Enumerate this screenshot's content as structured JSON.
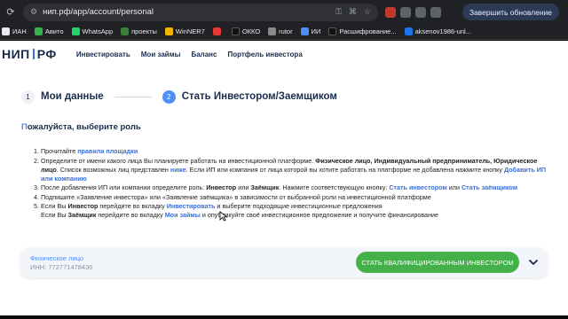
{
  "browser": {
    "url": "нип.рф/app/account/personal",
    "update_button": "Завершить обновление",
    "bookmarks": [
      "ИАН",
      "Авито",
      "WhatsApp",
      "проекты",
      "WinNER7",
      "",
      "ОККО",
      "rutor",
      "ИИ",
      "Расшифрование...",
      "aksenov1986-unl..."
    ],
    "bookmark_colors": [
      "#e8eaed",
      "#37b24d",
      "#25d366",
      "#3b7d3b",
      "#f5b400",
      "#e53935",
      "#111111",
      "#8a8a8a",
      "#4f8ef7",
      "#111111",
      "#1a73e8"
    ]
  },
  "site": {
    "logo_left": "НИП",
    "logo_right": "РФ",
    "menu": [
      "Инвестировать",
      "Мои займы",
      "Баланс",
      "Портфель инвестора"
    ]
  },
  "steps": [
    {
      "num": "1",
      "label": "Мои данные"
    },
    {
      "num": "2",
      "label": "Стать Инвестором/Заемщиком"
    }
  ],
  "role_title_first": "П",
  "role_title_rest": "ожалуйста, выберите роль",
  "instructions": {
    "i1_pre": "Прочитайте ",
    "i1_link": "правила площадки",
    "i2_pre": "Определите от имени какого лица Вы планируете работать на инвестиционной платформе. ",
    "i2_bold": "Физическое лицо, Индивидуальный предприниматель, Юридическое лицо",
    "i2_mid": ". Список возможных лиц представлен ",
    "i2_link1": "ниже",
    "i2_post": ". Если ИП или компания от лица которой вы хотите работать на платформе не добавлена нажмите кнопку ",
    "i2_link2": "Добавить ИП или компанию",
    "i3_pre": "После добавления ИП или компании определите роль: ",
    "i3_b1": "Инвестор",
    "i3_mid1": " или ",
    "i3_b2": "Заёмщик",
    "i3_mid2": ". Нажмите соответствующую кнопку: ",
    "i3_link1": "Стать инвестором",
    "i3_mid3": " или ",
    "i3_link2": "Стать заёмщиком",
    "i4": "Подпишите «Заявление инвестора» или «Заявление заёмщика» в зависимости от выбранной роли на инвестиционной платформе",
    "i5a_pre": "Если Вы ",
    "i5a_b": "Инвестор",
    "i5a_mid": " перейдите во вкладку ",
    "i5a_link": "Инвестировать",
    "i5a_post": " и выберите подходящие инвестиционные предложения",
    "i5b_pre": "Если Вы ",
    "i5b_b": "Заёмщик",
    "i5b_mid": " перейдите во вкладку ",
    "i5b_link": "Мои займы",
    "i5b_post": " и опубликуйте своё инвестиционное предложение и получите финансирование"
  },
  "role_card": {
    "name": "Физическое лицо",
    "inn": "ИНН: 772771478436",
    "button": "СТАТЬ КВАЛИФИЦИРОВАННЫМ ИНВЕСТОРОМ"
  }
}
